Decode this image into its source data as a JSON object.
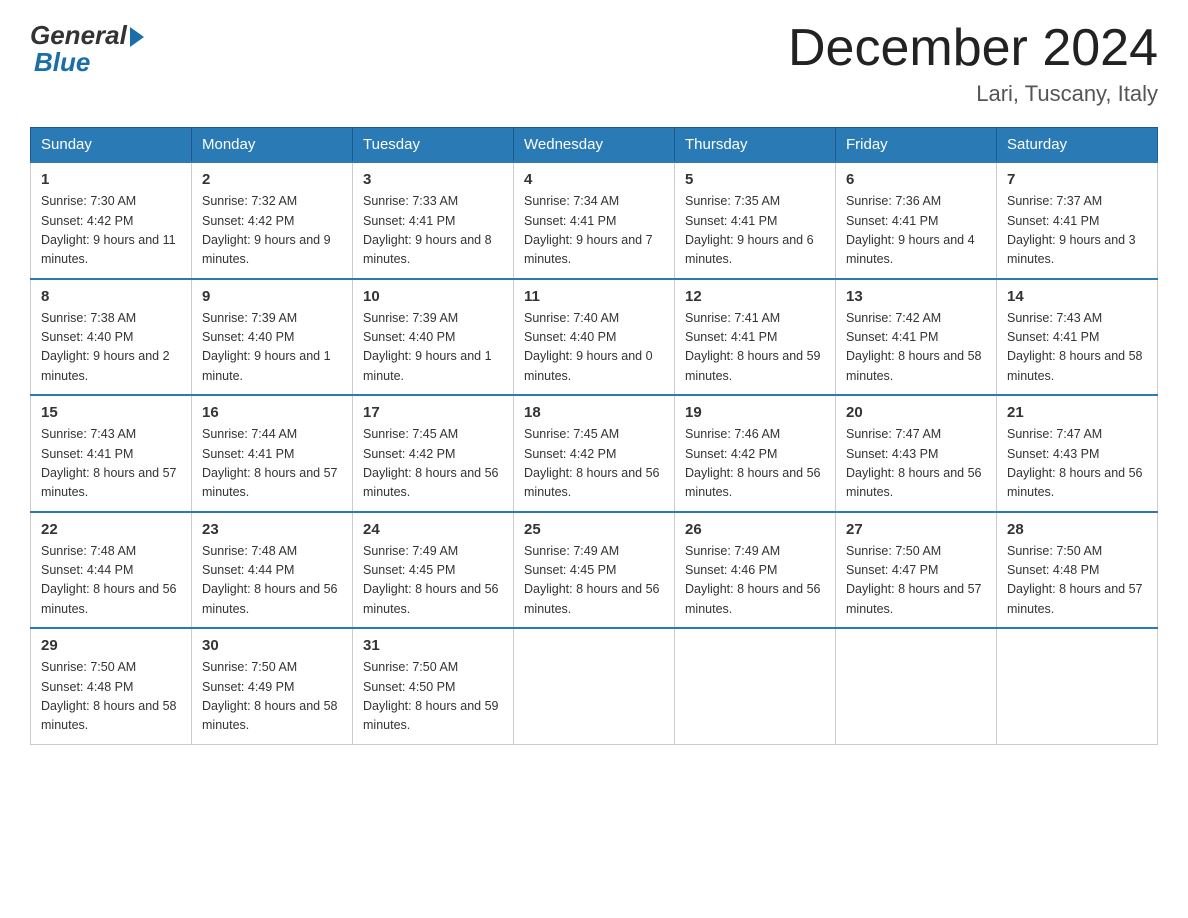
{
  "header": {
    "logo_general": "General",
    "logo_blue": "Blue",
    "month_title": "December 2024",
    "location": "Lari, Tuscany, Italy"
  },
  "weekdays": [
    "Sunday",
    "Monday",
    "Tuesday",
    "Wednesday",
    "Thursday",
    "Friday",
    "Saturday"
  ],
  "weeks": [
    [
      {
        "day": "1",
        "sunrise": "7:30 AM",
        "sunset": "4:42 PM",
        "daylight": "9 hours and 11 minutes."
      },
      {
        "day": "2",
        "sunrise": "7:32 AM",
        "sunset": "4:42 PM",
        "daylight": "9 hours and 9 minutes."
      },
      {
        "day": "3",
        "sunrise": "7:33 AM",
        "sunset": "4:41 PM",
        "daylight": "9 hours and 8 minutes."
      },
      {
        "day": "4",
        "sunrise": "7:34 AM",
        "sunset": "4:41 PM",
        "daylight": "9 hours and 7 minutes."
      },
      {
        "day": "5",
        "sunrise": "7:35 AM",
        "sunset": "4:41 PM",
        "daylight": "9 hours and 6 minutes."
      },
      {
        "day": "6",
        "sunrise": "7:36 AM",
        "sunset": "4:41 PM",
        "daylight": "9 hours and 4 minutes."
      },
      {
        "day": "7",
        "sunrise": "7:37 AM",
        "sunset": "4:41 PM",
        "daylight": "9 hours and 3 minutes."
      }
    ],
    [
      {
        "day": "8",
        "sunrise": "7:38 AM",
        "sunset": "4:40 PM",
        "daylight": "9 hours and 2 minutes."
      },
      {
        "day": "9",
        "sunrise": "7:39 AM",
        "sunset": "4:40 PM",
        "daylight": "9 hours and 1 minute."
      },
      {
        "day": "10",
        "sunrise": "7:39 AM",
        "sunset": "4:40 PM",
        "daylight": "9 hours and 1 minute."
      },
      {
        "day": "11",
        "sunrise": "7:40 AM",
        "sunset": "4:40 PM",
        "daylight": "9 hours and 0 minutes."
      },
      {
        "day": "12",
        "sunrise": "7:41 AM",
        "sunset": "4:41 PM",
        "daylight": "8 hours and 59 minutes."
      },
      {
        "day": "13",
        "sunrise": "7:42 AM",
        "sunset": "4:41 PM",
        "daylight": "8 hours and 58 minutes."
      },
      {
        "day": "14",
        "sunrise": "7:43 AM",
        "sunset": "4:41 PM",
        "daylight": "8 hours and 58 minutes."
      }
    ],
    [
      {
        "day": "15",
        "sunrise": "7:43 AM",
        "sunset": "4:41 PM",
        "daylight": "8 hours and 57 minutes."
      },
      {
        "day": "16",
        "sunrise": "7:44 AM",
        "sunset": "4:41 PM",
        "daylight": "8 hours and 57 minutes."
      },
      {
        "day": "17",
        "sunrise": "7:45 AM",
        "sunset": "4:42 PM",
        "daylight": "8 hours and 56 minutes."
      },
      {
        "day": "18",
        "sunrise": "7:45 AM",
        "sunset": "4:42 PM",
        "daylight": "8 hours and 56 minutes."
      },
      {
        "day": "19",
        "sunrise": "7:46 AM",
        "sunset": "4:42 PM",
        "daylight": "8 hours and 56 minutes."
      },
      {
        "day": "20",
        "sunrise": "7:47 AM",
        "sunset": "4:43 PM",
        "daylight": "8 hours and 56 minutes."
      },
      {
        "day": "21",
        "sunrise": "7:47 AM",
        "sunset": "4:43 PM",
        "daylight": "8 hours and 56 minutes."
      }
    ],
    [
      {
        "day": "22",
        "sunrise": "7:48 AM",
        "sunset": "4:44 PM",
        "daylight": "8 hours and 56 minutes."
      },
      {
        "day": "23",
        "sunrise": "7:48 AM",
        "sunset": "4:44 PM",
        "daylight": "8 hours and 56 minutes."
      },
      {
        "day": "24",
        "sunrise": "7:49 AM",
        "sunset": "4:45 PM",
        "daylight": "8 hours and 56 minutes."
      },
      {
        "day": "25",
        "sunrise": "7:49 AM",
        "sunset": "4:45 PM",
        "daylight": "8 hours and 56 minutes."
      },
      {
        "day": "26",
        "sunrise": "7:49 AM",
        "sunset": "4:46 PM",
        "daylight": "8 hours and 56 minutes."
      },
      {
        "day": "27",
        "sunrise": "7:50 AM",
        "sunset": "4:47 PM",
        "daylight": "8 hours and 57 minutes."
      },
      {
        "day": "28",
        "sunrise": "7:50 AM",
        "sunset": "4:48 PM",
        "daylight": "8 hours and 57 minutes."
      }
    ],
    [
      {
        "day": "29",
        "sunrise": "7:50 AM",
        "sunset": "4:48 PM",
        "daylight": "8 hours and 58 minutes."
      },
      {
        "day": "30",
        "sunrise": "7:50 AM",
        "sunset": "4:49 PM",
        "daylight": "8 hours and 58 minutes."
      },
      {
        "day": "31",
        "sunrise": "7:50 AM",
        "sunset": "4:50 PM",
        "daylight": "8 hours and 59 minutes."
      },
      null,
      null,
      null,
      null
    ]
  ]
}
